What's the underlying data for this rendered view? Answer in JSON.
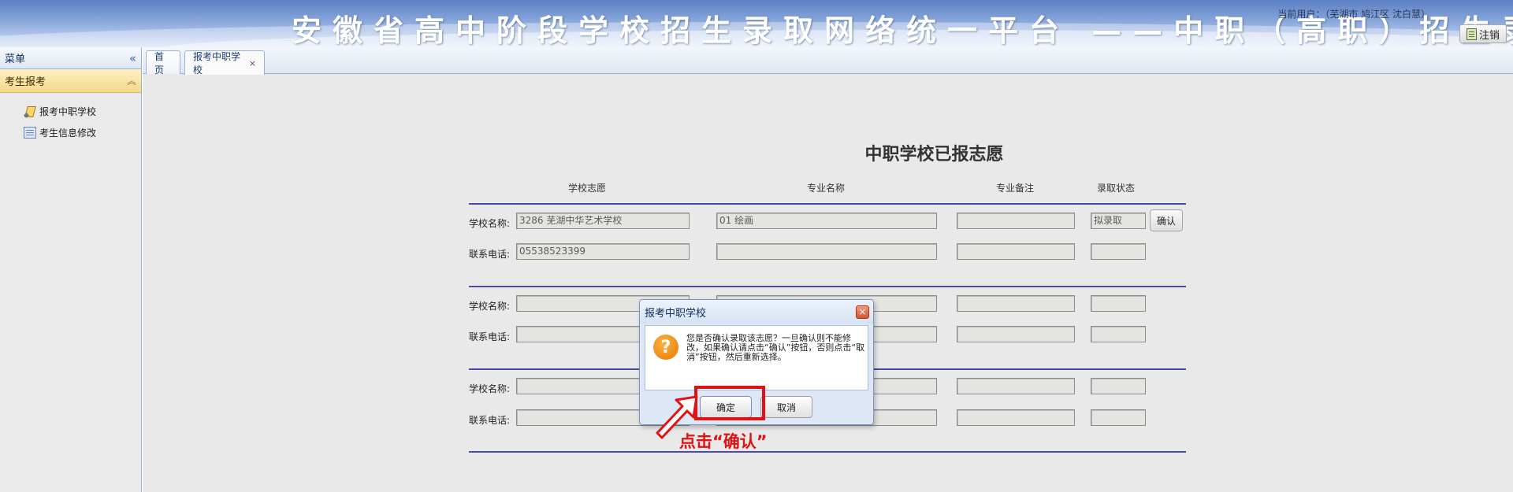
{
  "header": {
    "title": "安徽省高中阶段学校招生录取网络统一平台  ——中职（高职）招生录取",
    "user_info": "当前用户：（芜湖市 鸠江区 沈白慧）",
    "logout_label": "注销"
  },
  "sidebar": {
    "title": "菜单",
    "group": "考生报考",
    "items": [
      {
        "label": "报考中职学校"
      },
      {
        "label": "考生信息修改"
      }
    ]
  },
  "tabs": [
    {
      "label": "首页"
    },
    {
      "label": "报考中职学校",
      "close": "×"
    }
  ],
  "form": {
    "title": "中职学校已报志愿",
    "columns": [
      "学校志愿",
      "专业名称",
      "专业备注",
      "录取状态"
    ],
    "school_label": "学校名称:",
    "phone_label": "联系电话:",
    "confirm_label": "确认",
    "entries": [
      {
        "school": "3286 芜湖中华艺术学校",
        "major": "01 绘画",
        "note": "",
        "status": "拟录取",
        "phone": "05538523399"
      },
      {
        "school": "",
        "major": "",
        "note": "",
        "status": "",
        "phone": ""
      },
      {
        "school": "",
        "major": "",
        "note": "",
        "status": "",
        "phone": ""
      }
    ]
  },
  "dialog": {
    "title": "报考中职学校",
    "close": "×",
    "icon_glyph": "?",
    "message": "您是否确认录取该志愿？一旦确认则不能修改，如果确认请点击“确认”按钮，否则点击“取消”按钮，然后重新选择。",
    "ok_label": "确定",
    "cancel_label": "取消"
  },
  "annotation": {
    "text": "点击“确认”",
    "color": "#e21212"
  }
}
